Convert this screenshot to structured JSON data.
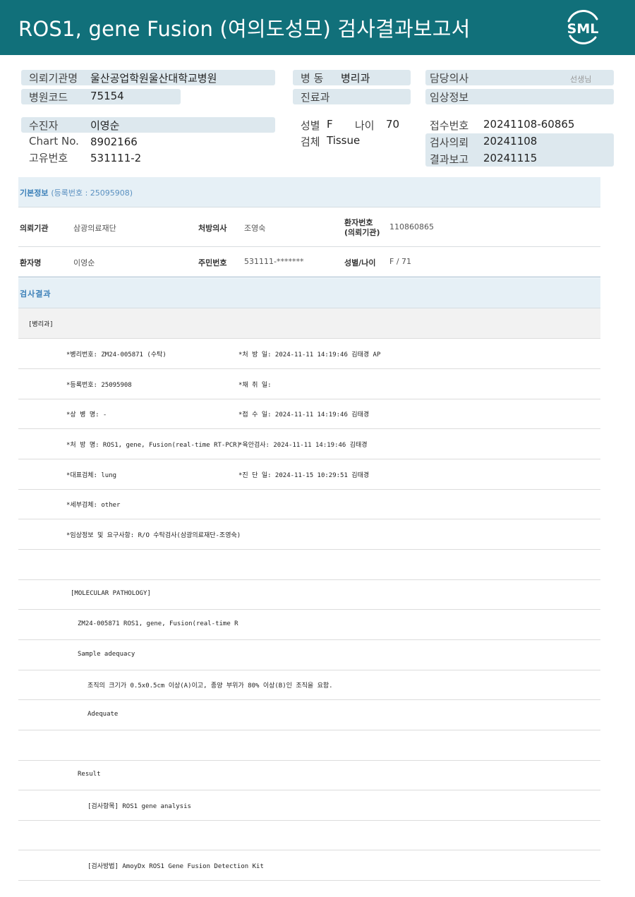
{
  "header": {
    "title": "ROS1, gene Fusion (여의도성모) 검사결과보고서",
    "logo_text": "SML"
  },
  "patient_summary": {
    "requesting_org_label": "의뢰기관명",
    "requesting_org_value": "울산공업학원울산대학교병원",
    "hospital_code_label": "병원코드",
    "hospital_code_value": "75154",
    "ward_label": "병 동",
    "ward_value": "병리과",
    "department_label": "진료과",
    "department_value": "",
    "attending_label": "담당의사",
    "attending_value": "",
    "attending_suffix": "선생님",
    "clinical_info_label": "임상정보",
    "clinical_info_value": "",
    "examinee_label": "수진자",
    "examinee_value": "이영순",
    "chart_label": "Chart No.",
    "chart_value": "8902166",
    "unique_label": "고유번호",
    "unique_value": "531111-2",
    "sex_label": "성별",
    "sex_value": "F",
    "age_label": "나이",
    "age_value": "70",
    "specimen_label": "검체",
    "specimen_value": "Tissue",
    "receipt_label": "접수번호",
    "receipt_value": "20241108-60865",
    "request_label": "검사의뢰",
    "request_value": "20241108",
    "report_label": "결과보고",
    "report_value": "20241115"
  },
  "basic_info": {
    "title": "기본정보",
    "sub": "(등록번호 : 25095908)",
    "row1": [
      {
        "label": "의뢰기관",
        "value": "삼광의료재단"
      },
      {
        "label": "처방의사",
        "value": "조영숙"
      },
      {
        "label_line1": "환자번호",
        "label_line2": "(의뢰기관)",
        "value": "110860865"
      }
    ],
    "row2": [
      {
        "label": "환자명",
        "value": "이영순"
      },
      {
        "label": "주민번호",
        "value": "531111-*******"
      },
      {
        "label": "성별/나이",
        "value": "F / 71"
      }
    ]
  },
  "results": {
    "title": "검사결과",
    "dept_tag": "[병리과]",
    "rows": [
      {
        "left": "*병리번호: ZM24-005871 (수탁)",
        "right": "*처 방 일: 2024-11-11 14:19:46  김태경 AP"
      },
      {
        "left": "*등록번호: 25095908",
        "right": "*채 취 일:"
      },
      {
        "left": "*상 병 명: -",
        "right": "*접 수 일: 2024-11-11 14:19:46  김태경"
      },
      {
        "left": "*처 방 명: ROS1, gene, Fusion(real-time RT-PCR)",
        "right": "*육안검사: 2024-11-11 14:19:46  김태경"
      },
      {
        "left": "*대표검체: lung",
        "right": "*진 단 일: 2024-11-15 10:29:51  김태경"
      },
      {
        "left": "*세부검체: other",
        "right": ""
      },
      {
        "left": "*임상정보 및 요구사항: R/O 수탁검사(삼광의료재단-조영숙)",
        "right": ""
      },
      {
        "left": "",
        "right": ""
      },
      {
        "left": "[MOLECULAR PATHOLOGY]",
        "right": ""
      },
      {
        "left": "ZM24-005871     ROS1, gene, Fusion(real-time R",
        "right": ""
      },
      {
        "left": "Sample adequacy",
        "right": ""
      },
      {
        "left": "조직의 크기가 0.5x0.5cm 이상(A)이고, 종양 부위가 80% 이상(B)인 조직을 요함.",
        "right": ""
      },
      {
        "left": "Adequate",
        "right": ""
      },
      {
        "left": "",
        "right": ""
      },
      {
        "left": "Result",
        "right": ""
      },
      {
        "left": "[검사항목] ROS1 gene analysis",
        "right": ""
      },
      {
        "left": "",
        "right": ""
      },
      {
        "left": "[검사방법] AmoyDx ROS1 Gene Fusion Detection Kit",
        "right": ""
      }
    ]
  },
  "colors": {
    "header_bg": "#11707a",
    "pill_bg": "#dde8ee",
    "section_bg": "#e6f0f6",
    "accent_text": "#3a7fb8"
  }
}
